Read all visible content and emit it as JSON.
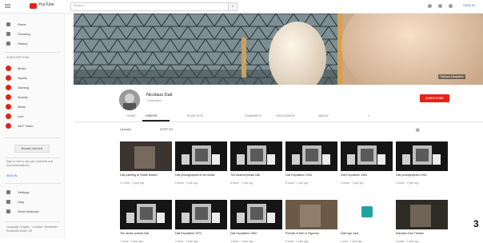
{
  "topbar": {
    "logo_text": "YouTube",
    "search_placeholder": "Search",
    "signin_label": "SIGN IN"
  },
  "sidebar": {
    "items_top": [
      {
        "label": "Home"
      },
      {
        "label": "Trending"
      },
      {
        "label": "History"
      }
    ],
    "subscriptions_heading": "SUBSCRIPTIONS",
    "subscriptions": [
      {
        "label": "Music"
      },
      {
        "label": "Sports"
      },
      {
        "label": "Gaming"
      },
      {
        "label": "Movies"
      },
      {
        "label": "News"
      },
      {
        "label": "Live"
      },
      {
        "label": "360° Video"
      }
    ],
    "browse_button": "Browse channels",
    "signin_prompt": "Sign in now to see your channels and recommendations!",
    "signin_link": "SIGN IN",
    "items_bottom": [
      {
        "label": "Settings"
      },
      {
        "label": "Help"
      },
      {
        "label": "Send feedback"
      }
    ],
    "footer_text": "Language: English · Location: Worldwide · Restricted Mode: Off"
  },
  "banner": {
    "meta_label": "Tristram Kantyshev"
  },
  "channel": {
    "name": "Nicolaus Dalí",
    "subscribers": "1 subscriber",
    "subscribe_label": "SUBSCRIBE"
  },
  "tabs": [
    {
      "label": "HOME"
    },
    {
      "label": "VIDEOS"
    },
    {
      "label": "PLAYLISTS"
    },
    {
      "label": "CHANNELS"
    },
    {
      "label": "DISCUSSION"
    },
    {
      "label": "ABOUT"
    }
  ],
  "sort": {
    "uploads_label": "Uploads",
    "sort_label": "SORT BY"
  },
  "videos": [
    {
      "title": "Dalí painting at Teatre Museo",
      "meta": "12 views · 1 year ago"
    },
    {
      "title": "Dalí photographed in his studio",
      "meta": "6 views · 1 year ago"
    },
    {
      "title": "The Anamorphosis Dalí",
      "meta": "8 views · 1 year ago"
    },
    {
      "title": "Dalí Exposition 1934",
      "meta": "5 views · 1 year ago"
    },
    {
      "title": "Dalí Exposition 1964",
      "meta": "3 views · 1 year ago"
    },
    {
      "title": "Dalí photographed 1962",
      "meta": "4 views · 1 year ago"
    },
    {
      "title": "The studio portrait Dalí",
      "meta": "7 views · 1 year ago"
    },
    {
      "title": "Dalí Exposition 1972",
      "meta": "2 views · 1 year ago"
    },
    {
      "title": "Dalí Exposition 1962",
      "meta": "4 views · 1 year ago"
    },
    {
      "title": "Portrait of Dalí in Figueres",
      "meta": "5 views · 1 year ago"
    },
    {
      "title": "Dalí logo card",
      "meta": "1 view · 1 year ago"
    },
    {
      "title": "Salvador Dalí Theatre",
      "meta": "9 views · 1 year ago"
    }
  ],
  "page_number": "3"
}
